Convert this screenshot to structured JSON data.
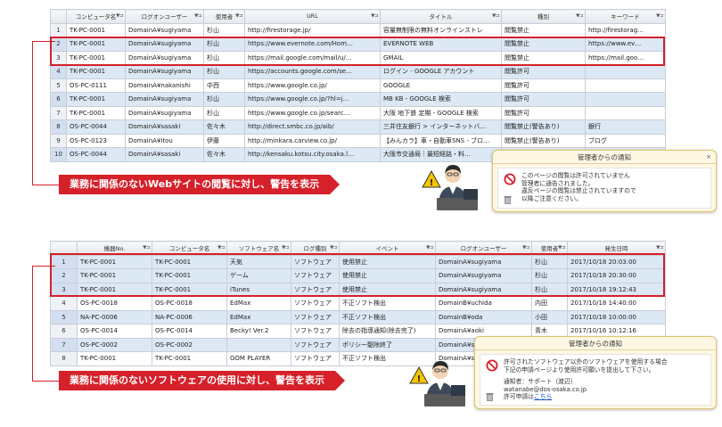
{
  "top_table": {
    "headers": [
      "コンピュータ名",
      "ログオンユーザー",
      "使用者",
      "URL",
      "タイトル",
      "種別",
      "キーワード"
    ],
    "filter_icon": "▼⊐",
    "rows": [
      [
        "1",
        "TK-PC-0001",
        "DomainA¥sugiyama",
        "杉山",
        "http://firestorage.jp/",
        "容量無制限の無料オンラインストレ",
        "閲覧禁止",
        "http://firestorag…"
      ],
      [
        "2",
        "TK-PC-0001",
        "DomainA¥sugiyama",
        "杉山",
        "https://www.evernote.com/Hom…",
        "EVERNOTE WEB",
        "閲覧禁止",
        "https://www.ev…"
      ],
      [
        "3",
        "TK-PC-0001",
        "DomainA¥sugiyama",
        "杉山",
        "https://mail.google.com/mail/u/…",
        "GMAIL",
        "閲覧禁止",
        "https://mail.goo…"
      ],
      [
        "4",
        "TK-PC-0001",
        "DomainA¥sugiyama",
        "杉山",
        "https://accounts.google.com/se…",
        "ログイン - GOOGLE アカウント",
        "閲覧許可",
        ""
      ],
      [
        "5",
        "OS-PC-0111",
        "DomainA¥nakanishi",
        "中西",
        "https://www.google.co.jp/",
        "GOOGLE",
        "閲覧許可",
        ""
      ],
      [
        "6",
        "TK-PC-0001",
        "DomainA¥sugiyama",
        "杉山",
        "https://www.google.co.jp/?hl=j…",
        "MB KB - GOOGLE 検索",
        "閲覧許可",
        ""
      ],
      [
        "7",
        "TK-PC-0001",
        "DomainA¥sugiyama",
        "杉山",
        "https://www.google.co.jp/searc…",
        "大阪 地下鉄 定期 - GOOGLE 検索",
        "閲覧許可",
        ""
      ],
      [
        "8",
        "OS-PC-0044",
        "DomainA¥sasaki",
        "佐々木",
        "http://direct.smbc.co.jp/aib/",
        "三井住友銀行 > インターネットバ…",
        "閲覧禁止(警告あり)",
        "銀行"
      ],
      [
        "9",
        "OS-PC-0123",
        "DomainA¥itou",
        "伊藤",
        "http://minkara.carview.co.jp/",
        "【みんカラ】車・自動車SNS - ブロ…",
        "閲覧禁止(警告あり)",
        "ブログ"
      ],
      [
        "10",
        "OS-PC-0044",
        "DomainA¥sasaki",
        "佐々木",
        "http://kensaku.kotsu.city.osaka.l…",
        "大阪市交通局｜最短経路・料…",
        "",
        ""
      ]
    ]
  },
  "top_banner": "業務に関係のないWebサイトの閲覧に対し、警告を表示",
  "top_popup": {
    "title": "管理者からの通知",
    "close": "×",
    "lines": [
      "このページの閲覧は許可されていません",
      "管理者に通告されました。",
      "違反ページの閲覧は禁止されていますので",
      "以降ご注意ください。"
    ]
  },
  "bottom_table": {
    "headers": [
      "機器No.",
      "コンピュータ名",
      "ソフトウェア名",
      "ログ種別",
      "イベント",
      "ログオンユーザー",
      "使用者",
      "発生日時"
    ],
    "filter_icon": "▼⊐",
    "rows": [
      [
        "1",
        "TK-PC-0001",
        "TK-PC-0001",
        "天気",
        "ソフトウェア",
        "使用禁止",
        "DomainA¥sugiyama",
        "杉山",
        "2017/10/18 20:03:00"
      ],
      [
        "2",
        "TK-PC-0001",
        "TK-PC-0001",
        "ゲーム",
        "ソフトウェア",
        "使用禁止",
        "DomainA¥sugiyama",
        "杉山",
        "2017/10/18 20:30:00"
      ],
      [
        "3",
        "TK-PC-0001",
        "TK-PC-0001",
        "iTunes",
        "ソフトウェア",
        "使用禁止",
        "DomainA¥sugiyama",
        "杉山",
        "2017/10/18 19:12:43"
      ],
      [
        "4",
        "OS-PC-0018",
        "OS-PC-0018",
        "EdMax",
        "ソフトウェア",
        "不正ソフト検出",
        "DomainB¥uchida",
        "内田",
        "2017/10/18 14:40:00"
      ],
      [
        "5",
        "NA-PC-0006",
        "NA-PC-0006",
        "EdMax",
        "ソフトウェア",
        "不正ソフト検出",
        "DomainB¥oda",
        "小田",
        "2017/10/18 10:00:00"
      ],
      [
        "6",
        "OS-PC-0014",
        "OS-PC-0014",
        "Becky! Ver.2",
        "ソフトウェア",
        "除去の指導通知(除去完了)",
        "DomainA¥aoki",
        "青木",
        "2017/10/16 10:12:16"
      ],
      [
        "7",
        "OS-PC-0002",
        "OS-PC-0002",
        "",
        "ソフトウェア",
        "ポリシー駆除終了",
        "DomainA¥sasaki",
        "",
        ""
      ],
      [
        "8",
        "TK-PC-0001",
        "TK-PC-0001",
        "GOM PLAYER",
        "ソフトウェア",
        "不正ソフト検出",
        "DomainA¥sugiyama",
        "",
        ""
      ]
    ]
  },
  "bottom_banner": "業務に関係のないソフトウェアの使用に対し、警告を表示",
  "bottom_popup": {
    "title": "管理者からの通知",
    "lines": [
      "許可されたソフトウェア以外のソフトウェアを使用する場合",
      "下記の申請ページより使用許可願いを提出して下さい。"
    ],
    "contact_label": "通知者：サポート（渡辺）",
    "contact_email": "watanabe@dos-osaka.co.jp",
    "request_prefix": "許可申請は",
    "request_link": "こちら"
  },
  "colors": {
    "accent_red": "#d6202a",
    "row_stripe": "#dde8f5",
    "popup_bg": "#fdf7e3",
    "link": "#1a55c8"
  }
}
